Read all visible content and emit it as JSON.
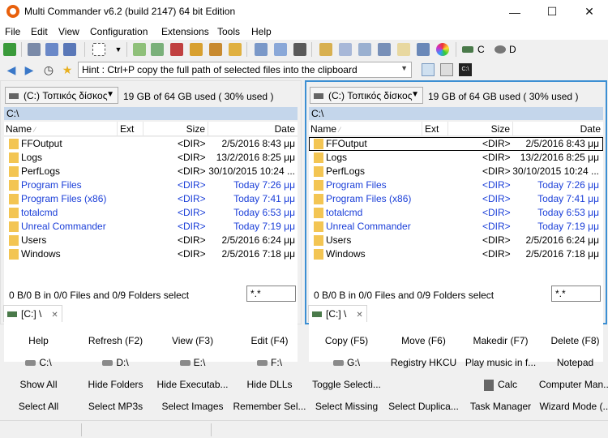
{
  "window": {
    "title": "Multi Commander v6.2 (build 2147) 64 bit Edition"
  },
  "menu": [
    "File",
    "Edit",
    "View",
    "Configuration",
    "Extensions",
    "Tools",
    "Help"
  ],
  "toolbar": {
    "drive_c": "C",
    "drive_d": "D"
  },
  "hint": {
    "text": "Hint : Ctrl+P copy the full path of selected files into the clipboard"
  },
  "columns": {
    "name": "Name",
    "ext": "Ext",
    "size": "Size",
    "date": "Date"
  },
  "left_panel": {
    "drive": "(C:) Τοπικός δίσκος",
    "space": "19 GB of 64 GB used ( 30% used )",
    "path": "C:\\",
    "status": "0 B/0 B in 0/0 Files and 0/9 Folders select",
    "filter": "*.*",
    "tab": "[C:] \\"
  },
  "right_panel": {
    "drive": "(C:) Τοπικός δίσκος",
    "space": "19 GB of 64 GB used ( 30% used )",
    "path": "C:\\",
    "status": "0 B/0 B in 0/0 Files and 0/9 Folders select",
    "filter": "*.*",
    "tab": "[C:] \\"
  },
  "files": [
    {
      "name": "FFOutput",
      "size": "<DIR>",
      "date": "2/5/2016 8:43 μμ",
      "blue": false
    },
    {
      "name": "Logs",
      "size": "<DIR>",
      "date": "13/2/2016 8:25 μμ",
      "blue": false
    },
    {
      "name": "PerfLogs",
      "size": "<DIR>",
      "date": "30/10/2015 10:24 ...",
      "blue": false
    },
    {
      "name": "Program Files",
      "size": "<DIR>",
      "date": "Today 7:26 μμ",
      "blue": true
    },
    {
      "name": "Program Files (x86)",
      "size": "<DIR>",
      "date": "Today 7:41 μμ",
      "blue": true
    },
    {
      "name": "totalcmd",
      "size": "<DIR>",
      "date": "Today 6:53 μμ",
      "blue": true
    },
    {
      "name": "Unreal Commander",
      "size": "<DIR>",
      "date": "Today 7:19 μμ",
      "blue": true
    },
    {
      "name": "Users",
      "size": "<DIR>",
      "date": "2/5/2016 6:24 μμ",
      "blue": false
    },
    {
      "name": "Windows",
      "size": "<DIR>",
      "date": "2/5/2016 7:18 μμ",
      "blue": false
    }
  ],
  "buttons": [
    [
      "Help",
      "Refresh (F2)",
      "View (F3)",
      "Edit (F4)",
      "Copy (F5)",
      "Move (F6)",
      "Makedir (F7)",
      "Delete (F8)"
    ],
    [
      "C:\\",
      "D:\\",
      "E:\\",
      "F:\\",
      "G:\\",
      "Registry HKCU",
      "Play music in f...",
      "Notepad"
    ],
    [
      "Show All",
      "Hide Folders",
      "Hide Executab...",
      "Hide DLLs",
      "Toggle Selecti...",
      "Calc",
      "Computer Man..."
    ],
    [
      "Select All",
      "Select MP3s",
      "Select Images",
      "Remember Sel...",
      "Select Missing",
      "Select Duplica...",
      "Task Manager",
      "Wizard Mode (..."
    ]
  ]
}
